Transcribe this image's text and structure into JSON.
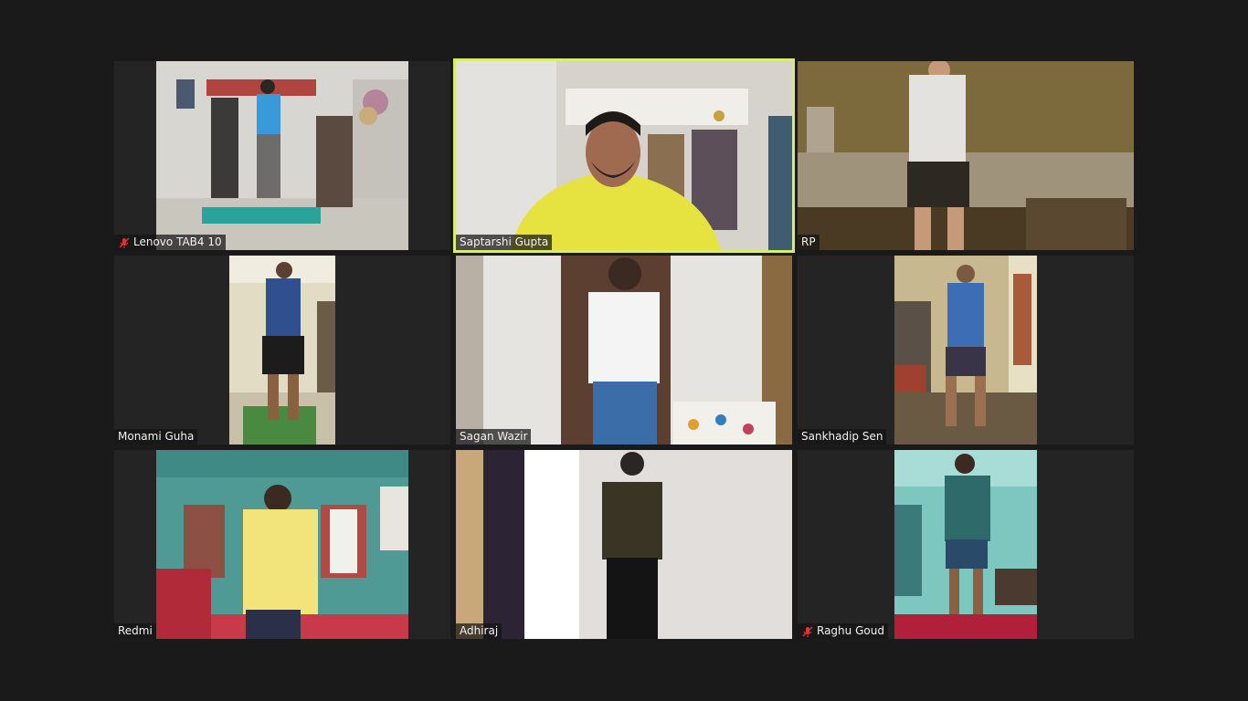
{
  "colors": {
    "background": "#1a1a1a",
    "tile_background": "#242424",
    "active_speaker_border": "#d8ee6a",
    "muted_icon": "#e5322d"
  },
  "participants": [
    {
      "name": "Lenovo TAB4 10",
      "muted": true,
      "active_speaker": false
    },
    {
      "name": "Saptarshi Gupta",
      "muted": false,
      "active_speaker": true
    },
    {
      "name": "RP",
      "muted": false,
      "active_speaker": false
    },
    {
      "name": "Monami Guha",
      "muted": false,
      "active_speaker": false
    },
    {
      "name": "Sagan Wazir",
      "muted": false,
      "active_speaker": false
    },
    {
      "name": "Sankhadip Sen",
      "muted": false,
      "active_speaker": false
    },
    {
      "name": "Redmi",
      "muted": false,
      "active_speaker": false
    },
    {
      "name": "Adhiraj",
      "muted": false,
      "active_speaker": false
    },
    {
      "name": "Raghu Goud",
      "muted": true,
      "active_speaker": false
    }
  ]
}
